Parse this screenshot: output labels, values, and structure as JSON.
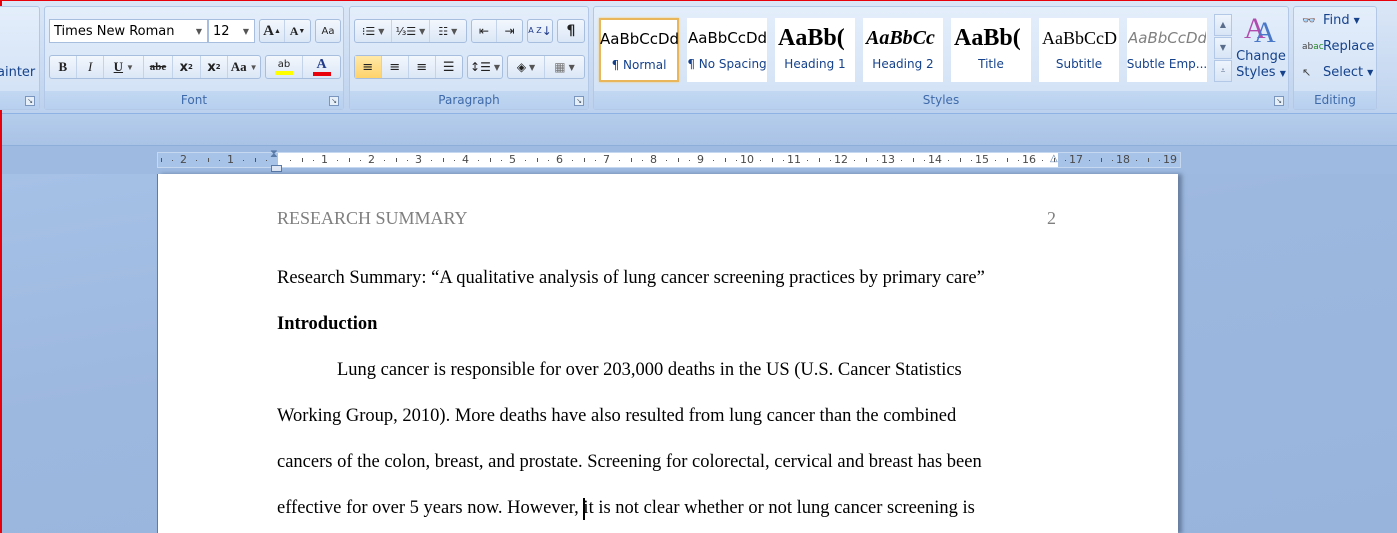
{
  "ribbon": {
    "clipboard": {
      "format_painter_partial": "ainter"
    },
    "font": {
      "label": "Font",
      "font_name": "Times New Roman",
      "font_size": "12",
      "grow_font": "A",
      "shrink_font": "A",
      "clear_formatting": "Aa",
      "bold": "B",
      "italic": "I",
      "underline": "U",
      "strikethrough": "abe",
      "subscript": "x",
      "superscript": "x",
      "change_case": "Aa",
      "highlight": "ab",
      "font_color": "A",
      "highlight_color": "#ffff00",
      "font_color_value": "#e8000b"
    },
    "paragraph": {
      "label": "Paragraph",
      "show_marks": "¶",
      "sort": "A Z"
    },
    "styles": {
      "label": "Styles",
      "items": [
        {
          "sample": "AaBbCcDd",
          "name": "¶ Normal",
          "selected": true
        },
        {
          "sample": "AaBbCcDd",
          "name": "¶ No Spacing"
        },
        {
          "sample": "AaBb(",
          "name": "Heading 1"
        },
        {
          "sample": "AaBbCc",
          "name": "Heading 2"
        },
        {
          "sample": "AaBb(",
          "name": "Title"
        },
        {
          "sample": "AaBbCcD",
          "name": "Subtitle"
        },
        {
          "sample": "AaBbCcDd",
          "name": "Subtle Emp..."
        }
      ],
      "change_styles": [
        "Change",
        "Styles"
      ]
    },
    "editing": {
      "label": "Editing",
      "find": "Find",
      "replace": "Replace",
      "select": "Select"
    }
  },
  "ruler": {
    "left_numbers": [
      "2",
      "1"
    ],
    "right_numbers": [
      "1",
      "2",
      "3",
      "4",
      "5",
      "6",
      "7",
      "8",
      "9",
      "10",
      "11",
      "12",
      "13",
      "14",
      "15",
      "16",
      "17",
      "18",
      "19"
    ]
  },
  "document": {
    "running_head": "RESEARCH SUMMARY",
    "page_number": "2",
    "title_line": "Research Summary: “A qualitative analysis of lung cancer screening practices by primary care”",
    "heading": "Introduction",
    "body_lines": [
      "Lung cancer is responsible for over 203,000 deaths in the US (U.S. Cancer Statistics",
      "Working Group, 2010). More deaths have also resulted from lung cancer than the combined",
      "cancers of the colon, breast, and prostate. Screening for colorectal, cervical and breast has been",
      "effective for over 5 years now. However, it is not clear whether or not lung cancer screening is"
    ]
  }
}
